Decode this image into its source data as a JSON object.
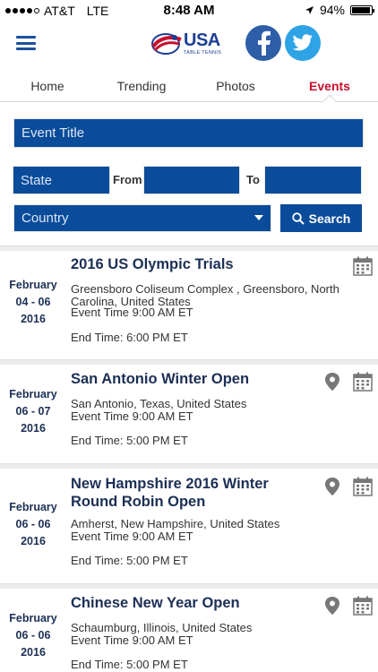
{
  "status_bar": {
    "carrier": "AT&T",
    "network": "LTE",
    "time": "8:48 AM",
    "battery": "94%",
    "battery_level": 0.94,
    "signal_bars": 4
  },
  "header": {
    "logo_text": "USA",
    "logo_subtext": "TABLE TENNIS"
  },
  "tabs": [
    {
      "label": "Home",
      "active": false
    },
    {
      "label": "Trending",
      "active": false
    },
    {
      "label": "Photos",
      "active": false
    },
    {
      "label": "Events",
      "active": true
    }
  ],
  "search": {
    "event_title_placeholder": "Event Title",
    "state_placeholder": "State",
    "from_label": "From",
    "to_label": "To",
    "country_placeholder": "Country",
    "search_label": "Search"
  },
  "events": [
    {
      "month": "February",
      "days": "04  - 06",
      "year": "2016",
      "title": "2016 US Olympic Trials",
      "location": "Greensboro Coliseum Complex , Greensboro, North Carolina, United States",
      "event_time": "Event Time 9:00 AM ET",
      "end_time": "End Time: 6:00 PM ET",
      "has_location_icon": false
    },
    {
      "month": "February",
      "days": "06  - 07",
      "year": "2016",
      "title": "San Antonio Winter Open",
      "location": "San Antonio, Texas, United States",
      "event_time": "Event Time 9:00 AM ET",
      "end_time": "End Time: 5:00 PM ET",
      "has_location_icon": true
    },
    {
      "month": "February",
      "days": "06  - 06",
      "year": "2016",
      "title": "New Hampshire 2016 Winter Round Robin Open",
      "location": "Amherst, New Hampshire, United States",
      "event_time": "Event Time 9:00 AM ET",
      "end_time": "End Time: 5:00 PM ET",
      "has_location_icon": true
    },
    {
      "month": "February",
      "days": "06  - 06",
      "year": "2016",
      "title": "Chinese New Year Open",
      "location": "Schaumburg, Illinois, United States",
      "event_time": "Event Time 9:00 AM ET",
      "end_time": "End Time: 5:00 PM ET",
      "has_location_icon": true
    }
  ],
  "colors": {
    "brand_blue": "#0a4c9a",
    "active_tab": "#c8102e",
    "title_navy": "#1c2f55",
    "facebook": "#2f5ea8",
    "twitter": "#2ea3e6"
  }
}
